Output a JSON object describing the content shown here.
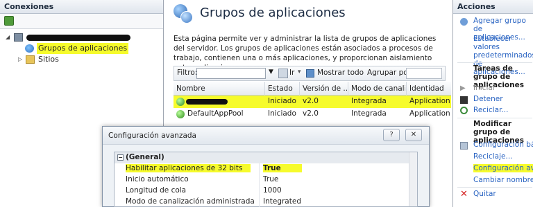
{
  "connections": {
    "title": "Conexiones",
    "tree": [
      {
        "label": "",
        "redacted": true
      },
      {
        "label": "Grupos de aplicaciones",
        "highlighted": true
      },
      {
        "label": "Sitios"
      }
    ]
  },
  "center": {
    "title": "Grupos de aplicaciones",
    "description": "Esta página permite ver y administrar la lista de grupos de aplicaciones del servidor. Los grupos de aplicaciones están asociados a procesos de trabajo, contienen una o más aplicaciones, y proporcionan aislamiento entre aplicaciones.",
    "filter": {
      "label": "Filtro:",
      "ir": "Ir",
      "show_all": "Mostrar todo",
      "group_by": "Agrupar por:"
    },
    "columns": [
      "Nombre",
      "Estado",
      "Versión de ...",
      "Modo de canaliz...",
      "Identidad"
    ],
    "rows": [
      {
        "name": "",
        "redacted": true,
        "state": "Iniciado",
        "version": "v2.0",
        "mode": "Integrada",
        "identity": "Application",
        "highlighted": true
      },
      {
        "name": "DefaultAppPool",
        "state": "Iniciado",
        "version": "v2.0",
        "mode": "Integrada",
        "identity": "Application"
      }
    ]
  },
  "actions": {
    "title": "Acciones",
    "add_group": "Agregar grupo de aplicaciones...",
    "set_defaults": "Establecer valores predeterminados de aplicaciones...",
    "tasks_heading": "Tareas de grupo de aplicaciones",
    "start": "Iniciar",
    "stop": "Detener",
    "recycle": "Reciclar...",
    "edit_heading": "Modificar grupo de aplicaciones",
    "basic_config": "Configuración básica...",
    "recycling": "Reciclaje...",
    "advanced_config": "Configuración avanzada...",
    "rename": "Cambiar nombre",
    "remove": "Quitar"
  },
  "dialog": {
    "title": "Configuración avanzada",
    "help_glyph": "?",
    "close_glyph": "✕",
    "category": "(General)",
    "properties": [
      {
        "key": "Habilitar aplicaciones de 32 bits",
        "value": "True",
        "highlighted": true
      },
      {
        "key": "Inicio automático",
        "value": "True"
      },
      {
        "key": "Longitud de cola",
        "value": "1000"
      },
      {
        "key": "Modo de canalización administrada",
        "value": "Integrated"
      }
    ]
  },
  "colors": {
    "highlight": "#f6fb2c",
    "link": "#2a64c2",
    "panel_header": "#dfe5ed"
  }
}
